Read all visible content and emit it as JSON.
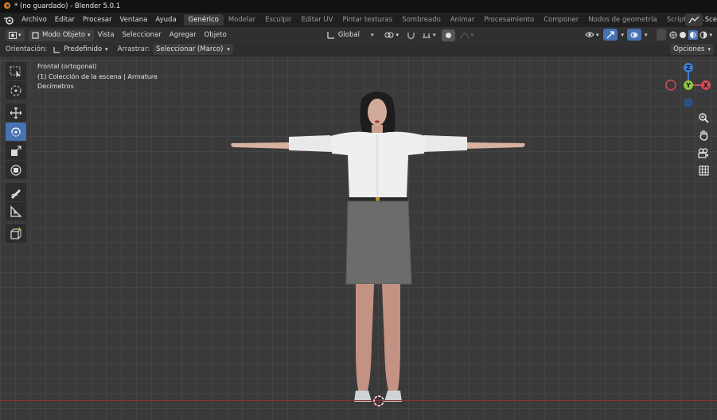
{
  "window": {
    "title": "* (no guardado) - Blender 5.0.1"
  },
  "menu": {
    "items": [
      "Archivo",
      "Editar",
      "Procesar",
      "Ventana",
      "Ayuda"
    ],
    "workspaces": [
      "Genérico",
      "Modelar",
      "Esculpir",
      "Editar UV",
      "Pintar texturas",
      "Sombreado",
      "Animar",
      "Procesamiento",
      "Componer",
      "Nodos de geometría",
      "Scripts"
    ],
    "active_workspace": "Genérico",
    "scene_label": "Sce"
  },
  "header": {
    "mode": "Modo Objeto",
    "menus": [
      "Vista",
      "Seleccionar",
      "Agregar",
      "Objeto"
    ],
    "transform_orientation": "Global"
  },
  "tool_settings": {
    "orientation_label": "Orientación:",
    "orientation_value": "Predefinido",
    "drag_label": "Arrastrar:",
    "drag_value": "Seleccionar (Marco)",
    "options_label": "Opciones"
  },
  "viewport": {
    "view_name": "Frontal (ortogonal)",
    "collection": "(1) Colección de la escena | Armature",
    "units": "Decímetros"
  },
  "gizmo": {
    "z": "Z",
    "y": "Y",
    "x": "X"
  },
  "colors": {
    "accent": "#4772b3",
    "x_axis": "#d3495a",
    "y_axis": "#8cc63e",
    "z_axis": "#3a7fd6",
    "ground_line": "#8c3434"
  },
  "icons": {
    "tools": [
      "select-box-icon",
      "cursor-icon",
      "move-icon",
      "rotate-icon",
      "scale-icon",
      "transform-icon",
      "annotate-icon",
      "measure-icon",
      "add-cube-icon"
    ],
    "nav": [
      "zoom-icon",
      "hand-pan-icon",
      "camera-icon",
      "grid-ortho-icon"
    ]
  }
}
